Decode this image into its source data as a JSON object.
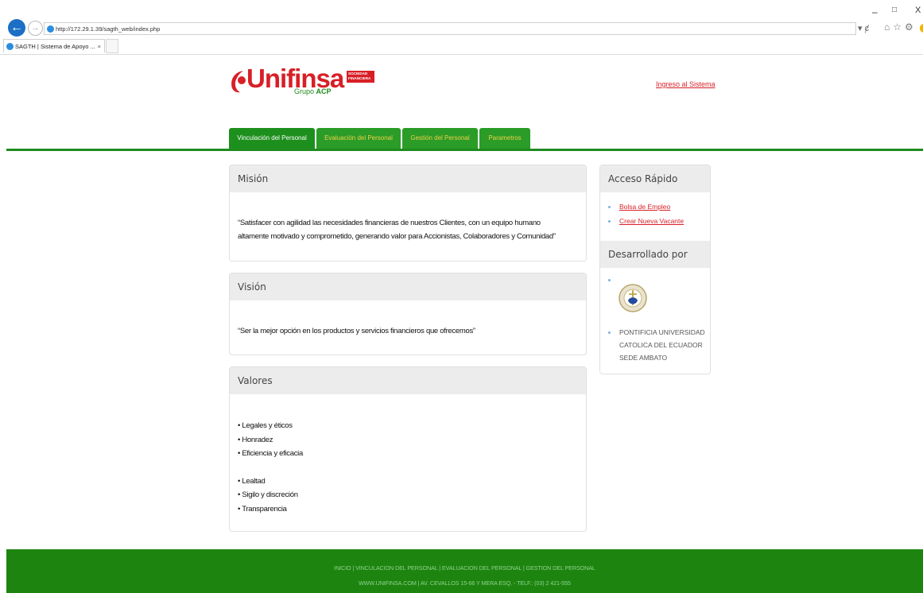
{
  "browser": {
    "url": "http://172.29.1.39/sagth_web/index.php",
    "tab_title": "SAGTH | Sistema de Apoyo ...",
    "tab_close": "×",
    "window_controls": {
      "minimize": "–",
      "maximize": "□",
      "close": "X"
    },
    "address_tools": "▾ ȼ",
    "toolbar_icons": "⌂☆⚙"
  },
  "header": {
    "logo_text": "Unifinsa",
    "logo_box_text": "SOCIEDAD FINANCIERA",
    "logo_grupo": "Grupo",
    "logo_grupo_brand": "ACP",
    "login_link": "Ingreso al Sistema"
  },
  "menu": {
    "items": [
      {
        "label": "Vinculación del Personal",
        "active": true
      },
      {
        "label": "Evaluación del Personal",
        "active": false
      },
      {
        "label": "Gestión del Personal",
        "active": false
      },
      {
        "label": "Parametros",
        "active": false
      }
    ]
  },
  "mision": {
    "title": "Misión",
    "text": "“Satisfacer con agilidad las necesidades financieras de nuestros Clientes, con un equipo humano altamente motivado y comprometido, generando valor para Accionistas, Colaboradores y Comunidad”"
  },
  "vision": {
    "title": "Visión",
    "text": "“Ser la mejor opción en los productos y servicios financieros que ofrecemos”"
  },
  "valores": {
    "title": "Valores",
    "group1": [
      "• Legales y éticos",
      "• Honradez",
      "• Eficiencia y eficacia"
    ],
    "group2": [
      "• Lealtad",
      "• Sigilo y discreción",
      "• Transparencia"
    ]
  },
  "sidebar": {
    "quick_title": "Acceso Rápido",
    "links": [
      "Bolsa de Empleo",
      "Crear Nueva Vacante"
    ],
    "dev_title": "Desarrollado por",
    "university": [
      "PONTIFICIA UNIVERSIDAD",
      "CATOLICA DEL ECUADOR",
      "SEDE AMBATO"
    ]
  },
  "footer": {
    "line1": "INICIO | VINCULACION DEL PERSONAL | EVALUACION DEL PERSONAL | GESTION DEL PERSONAL",
    "line2": "WWW.UNIFINSA.COM | AV. CEVALLOS 15-66 Y MERA ESQ. - TELF.: (03) 2 421-555"
  },
  "colors": {
    "brand_red": "#d81f26",
    "brand_green": "#1d8f1d",
    "footer_green": "#1d850f",
    "panel_header": "#ececec"
  }
}
